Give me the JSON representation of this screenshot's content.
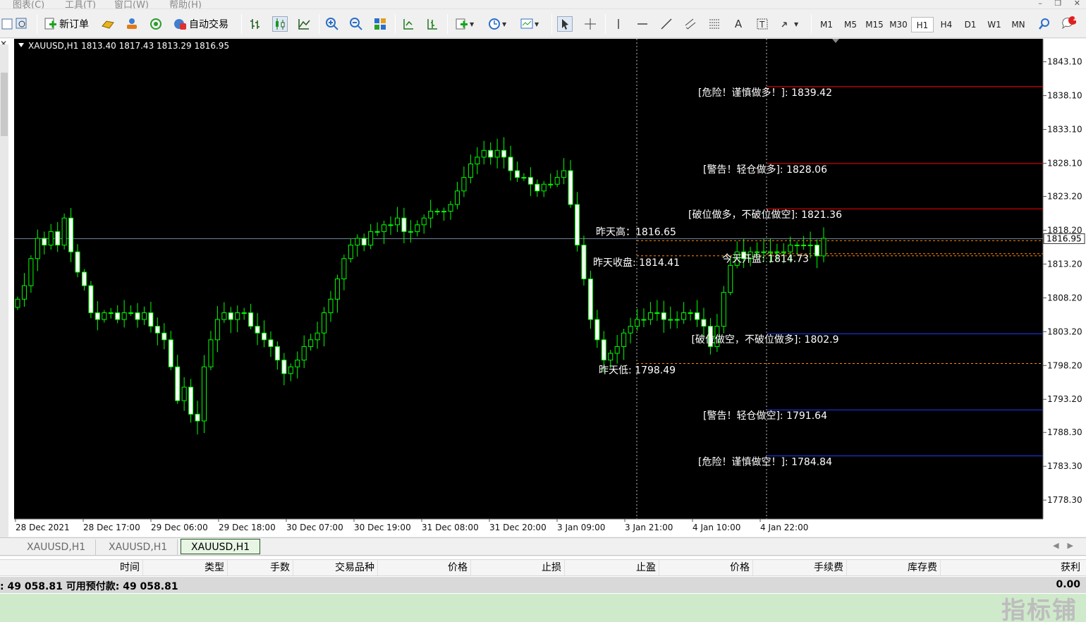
{
  "menu": {
    "items": [
      "图表(C)",
      "工具(T)",
      "窗口(W)",
      "帮助(H)"
    ]
  },
  "toolbar": {
    "new_order_label": "新订单",
    "auto_trade_label": "自动交易",
    "timeframes": [
      "M1",
      "M5",
      "M15",
      "M30",
      "H1",
      "H4",
      "D1",
      "W1",
      "MN"
    ],
    "active_timeframe": "H1",
    "notification_count": "1"
  },
  "chart": {
    "header": "XAUUSD,H1  1813.40 1817.43 1813.29 1816.95",
    "current_price": "1816.95",
    "colors": {
      "background": "#000000",
      "candle": "#00ff00",
      "bull_fill": "#000000",
      "bear_fill": "#ffffff",
      "level": "#ff0000",
      "support": "#1e3cff",
      "dashed": "#ff8c00"
    }
  },
  "chart_data": {
    "type": "candlestick",
    "symbol": "XAUUSD",
    "timeframe": "H1",
    "ohlc_header": {
      "open": 1813.4,
      "high": 1817.43,
      "low": 1813.29,
      "close": 1816.95
    },
    "ylim": [
      1775.5,
      1846.5
    ],
    "y_ticks": [
      1843.1,
      1838.1,
      1833.1,
      1828.1,
      1823.2,
      1818.2,
      1813.2,
      1808.2,
      1803.2,
      1798.2,
      1793.2,
      1788.3,
      1783.3,
      1778.3
    ],
    "x_ticks": [
      "28 Dec 2021",
      "28 Dec 17:00",
      "29 Dec 06:00",
      "29 Dec 18:00",
      "30 Dec 07:00",
      "30 Dec 19:00",
      "31 Dec 08:00",
      "31 Dec 20:00",
      "3 Jan 09:00",
      "3 Jan 21:00",
      "4 Jan 10:00",
      "4 Jan 22:00"
    ],
    "close_path": [
      1808,
      1810,
      1814,
      1817,
      1816,
      1818,
      1816,
      1820,
      1815,
      1812,
      1810,
      1806,
      1805,
      1806,
      1806,
      1805,
      1806,
      1806,
      1805,
      1806,
      1804,
      1803,
      1802,
      1798,
      1793,
      1795,
      1791,
      1790,
      1798,
      1802,
      1805,
      1806,
      1805,
      1806,
      1806,
      1804,
      1803,
      1802,
      1801,
      1799,
      1797,
      1798,
      1799,
      1801,
      1802,
      1803,
      1806,
      1808,
      1811,
      1814,
      1816,
      1817,
      1816,
      1818,
      1818,
      1819,
      1819,
      1820,
      1818,
      1818,
      1819,
      1820,
      1821,
      1821,
      1821,
      1822,
      1824,
      1826,
      1828,
      1829,
      1830,
      1829,
      1830,
      1829,
      1827,
      1826,
      1826,
      1825,
      1824,
      1825,
      1825,
      1826,
      1827,
      1822,
      1816,
      1811,
      1805,
      1802,
      1799,
      1800,
      1801,
      1803,
      1804,
      1805,
      1805,
      1806,
      1806,
      1805,
      1805,
      1805,
      1806,
      1806,
      1805,
      1804,
      1801,
      1804,
      1809,
      1813,
      1815,
      1814,
      1815,
      1815,
      1815,
      1815,
      1815,
      1815,
      1816,
      1816,
      1816,
      1816,
      1814.4,
      1817
    ],
    "levels": [
      {
        "label": "[危险！谨慎做多！]: 1839.42",
        "value": 1839.42,
        "color": "#ff0000"
      },
      {
        "label": "[警告！轻仓做多]: 1828.06",
        "value": 1828.06,
        "color": "#ff0000"
      },
      {
        "label": "[破位做多，不破位做空]: 1821.36",
        "value": 1821.36,
        "color": "#ff0000"
      },
      {
        "label": "[破位做空，不破位做多]: 1802.9",
        "value": 1802.9,
        "color": "#1e3cff"
      },
      {
        "label": "[警告！轻仓做空]: 1791.64",
        "value": 1791.64,
        "color": "#1e3cff"
      },
      {
        "label": "[危险！谨慎做空！]: 1784.84",
        "value": 1784.84,
        "color": "#1e3cff"
      }
    ],
    "dashed_levels": [
      {
        "label": "昨天高：1816.65",
        "value": 1816.65
      },
      {
        "label": "昨天收盘: 1814.41",
        "value": 1814.41
      },
      {
        "label": "今天开盘: 1814.73",
        "value": 1814.73
      },
      {
        "label": "昨天低: 1798.49",
        "value": 1798.49
      }
    ]
  },
  "tabs": [
    "XAUUSD,H1",
    "XAUUSD,H1",
    "XAUUSD,H1"
  ],
  "active_tab": 2,
  "terminal": {
    "headers": [
      "时间",
      "类型",
      "手数",
      "交易品种",
      "价格",
      "止损",
      "止盈",
      "价格",
      "手续费",
      "库存费",
      "获利"
    ],
    "balance_text": ": 49 058.81  可用预付款: 49 058.81",
    "total": "0.00"
  },
  "watermark": "指标铺"
}
